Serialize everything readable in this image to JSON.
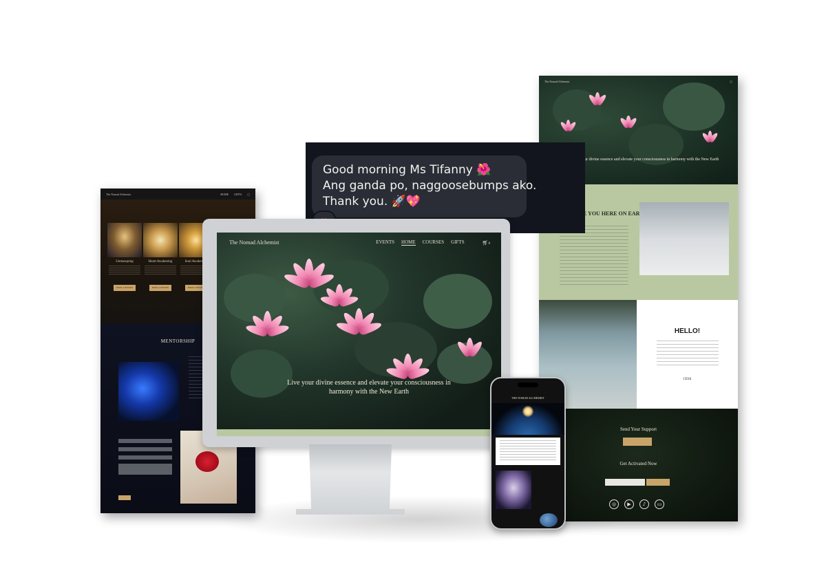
{
  "chat": {
    "message_lines": [
      "Good morning Ms Tifanny 🌺",
      "Ang ganda po, naggoosebumps ako.",
      "Thank you. 🚀💖"
    ],
    "reaction": "❤"
  },
  "desktop_site": {
    "brand": "The Nomad Alchemist",
    "nav_items": [
      "EVENTS",
      "HOME",
      "COURSES",
      "GIFTS"
    ],
    "active_nav": "HOME",
    "tagline": "Live your divine essence and elevate your consciousness in harmony with the New Earth",
    "cart_count": "0"
  },
  "left_site": {
    "brand": "The Nomad Alchemist",
    "nav_items": [
      "HOME",
      "GIFTS"
    ],
    "courses": [
      {
        "title": "Unmasquing",
        "button": "BOOK A SESSION"
      },
      {
        "title": "Heart Awakening",
        "button": "BOOK A SESSION"
      },
      {
        "title": "Soul Awakening",
        "button": "BOOK A SESSION"
      }
    ],
    "section_title": "MENTORSHIP"
  },
  "right_site": {
    "brand": "The Nomad Alchemist",
    "tagline": "Live your divine essence and elevate your consciousness in harmony with the New Earth",
    "heading_partial": "…E YOU HERE ON EARTH?",
    "hello_title": "HELLO!",
    "signature": "CESS",
    "support_title": "Send Your Support",
    "activated_title": "Get Activated Now",
    "social_icons": [
      "instagram-icon",
      "youtube-icon",
      "tiktok-icon",
      "chat-icon"
    ]
  },
  "phone_site": {
    "heading": "THE NOMAD ALCHEMIST"
  },
  "colors": {
    "gold_accent": "#c9a46a",
    "sage_green": "#b9c8a1",
    "dark_green": "#121d17",
    "lotus_pink": "#f189b4",
    "chat_bg": "#12151d",
    "bubble_bg": "#2a2d35"
  }
}
